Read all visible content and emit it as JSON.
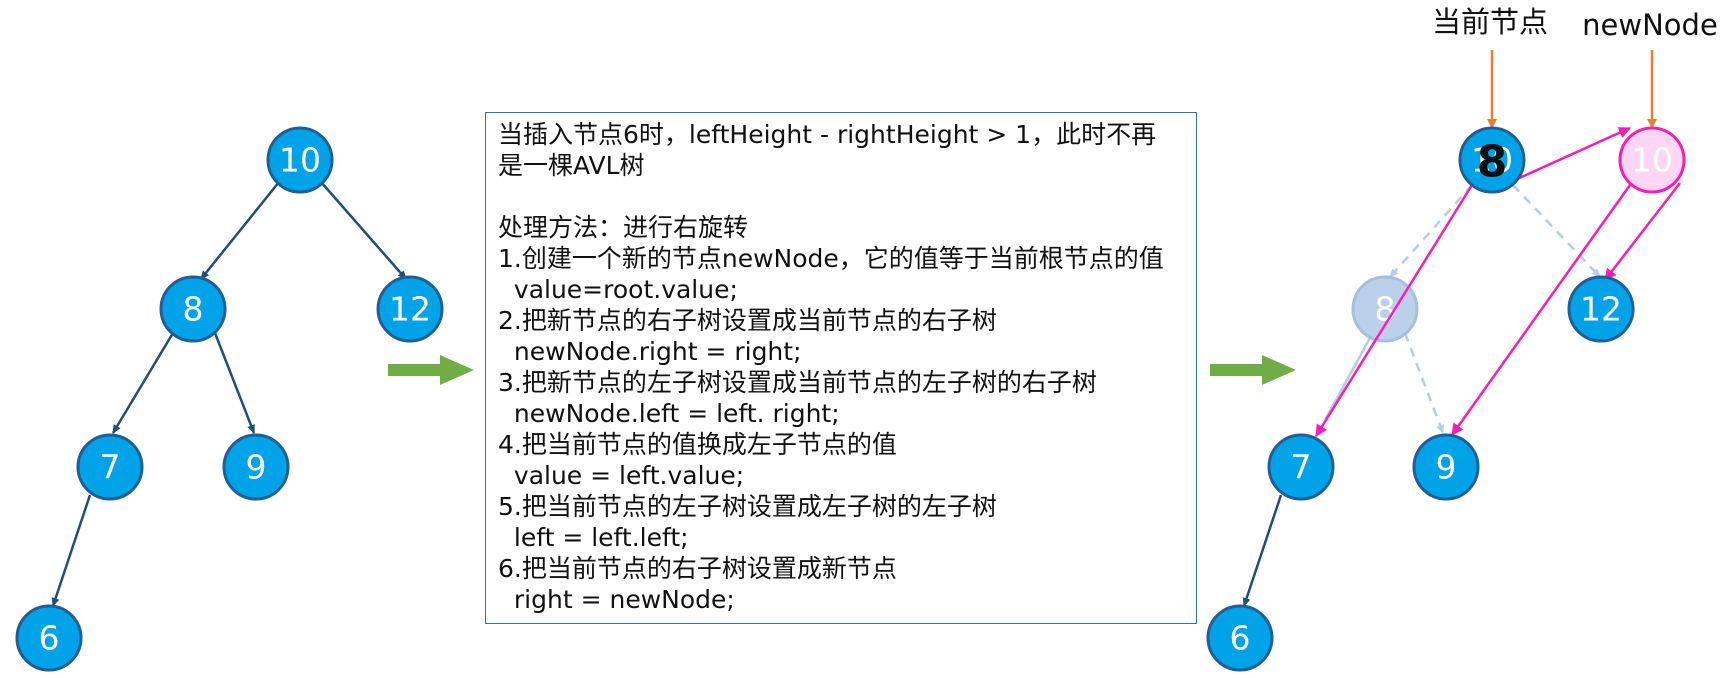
{
  "colors": {
    "node_fill": "#00a2e8",
    "node_stroke": "#1f5f95",
    "edge": "#1f4e79",
    "faded_node_fill": "#b4cde8",
    "faded_edge": "#b4cde8",
    "pink_node_fill": "#ffd6f3",
    "pink": "#ff1ab3",
    "orange": "#ed7d31",
    "green_arrow": "#70ad47",
    "box_border": "#2e75b6"
  },
  "left_tree": {
    "nodes": [
      "10",
      "8",
      "12",
      "7",
      "9",
      "6"
    ]
  },
  "description": {
    "lines": [
      "当插入节点6时，leftHeight - rightHeight > 1，此时不再",
      "是一棵AVL树",
      "",
      "处理方法：进行右旋转",
      "1.创建一个新的节点newNode，它的值等于当前根节点的值",
      "  value=root.value;",
      "2.把新节点的右子树设置成当前节点的右子树",
      "  newNode.right = right;",
      "3.把新节点的左子树设置成当前节点的左子树的右子树",
      "  newNode.left = left. right;",
      "4.把当前节点的值换成左子节点的值",
      "  value = left.value;",
      "5.把当前节点的左子树设置成左子树的左子树",
      "  left = left.left;",
      "6.把当前节点的右子树设置成新节点",
      "  right = newNode;"
    ]
  },
  "right_tree": {
    "label_current": "当前节点",
    "label_new_node": "newNode",
    "current_node_old_value": "10",
    "current_node_new_value": "8",
    "new_node_value": "10",
    "faded_node_value": "8",
    "nodes": [
      "12",
      "7",
      "9",
      "6"
    ]
  }
}
